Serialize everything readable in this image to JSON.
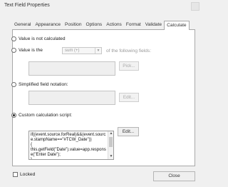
{
  "window": {
    "title": "Text Field Properties"
  },
  "tabs": [
    {
      "label": "General"
    },
    {
      "label": "Appearance"
    },
    {
      "label": "Position"
    },
    {
      "label": "Options"
    },
    {
      "label": "Actions"
    },
    {
      "label": "Format"
    },
    {
      "label": "Validate"
    },
    {
      "label": "Calculate",
      "active": true
    }
  ],
  "calculate": {
    "opt_not_calculated": "Value is not calculated",
    "opt_value_is": "Value is the",
    "function_select": "sum (+)",
    "following_fields": "of the following fields:",
    "pick_button": "Pick...",
    "opt_simplified": "Simplified field notation:",
    "edit_button_1": "Edit...",
    "opt_custom": "Custom calculation script:",
    "script": "if((event.source.forReal)&&(event.source.stampName==\"#TCW_Date\"))\n{\nthis.getField(\"Date\").value=app.response(\"Enter Date\");\n}",
    "edit_button_2": "Edit..."
  },
  "footer": {
    "locked_label": "Locked",
    "locked": false,
    "close_button": "Close"
  }
}
